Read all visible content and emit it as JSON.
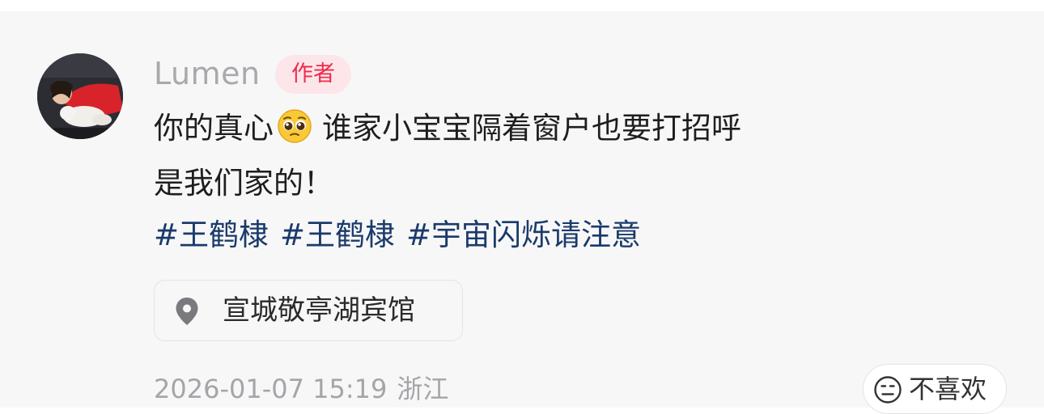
{
  "comment": {
    "username": "Lumen",
    "author_badge": "作者",
    "content": {
      "line1_before_emoji": "你的真心",
      "emoji": "pleading-face",
      "line1_after_emoji": "谁家小宝宝隔着窗户也要打招呼",
      "line2": "是我们家的！"
    },
    "hashtags": [
      "#王鹤棣",
      "#王鹤棣",
      "#宇宙闪烁请注意"
    ],
    "location": {
      "icon": "location-pin-icon",
      "text": "宣城敬亭湖宾馆"
    },
    "timestamp": "2026-01-07 15:19",
    "region": "浙江",
    "dislike_button": {
      "icon": "meh-face-icon",
      "label": "不喜欢"
    }
  },
  "colors": {
    "background": "#f7f7f7",
    "username": "#a9a9ad",
    "badge_background": "#fde6ea",
    "badge_text": "#ee2a4b",
    "hashtag": "#1b3a6b",
    "body_text": "#1e1e1e",
    "meta_text": "#a5a5a9"
  }
}
